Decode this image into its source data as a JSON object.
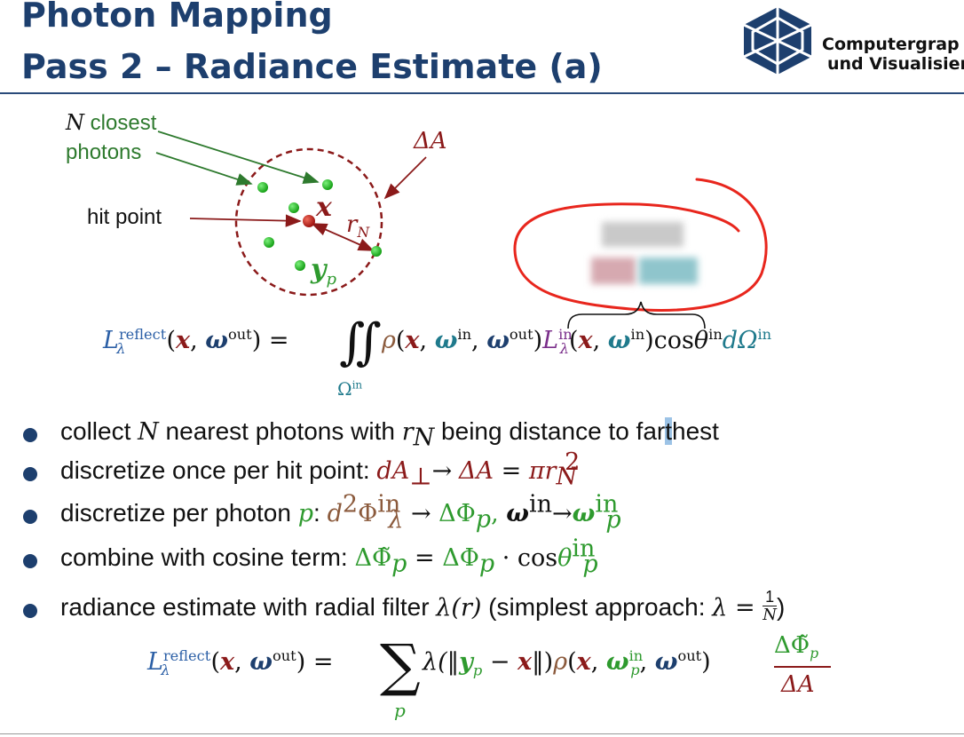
{
  "slide": {
    "title_line1": "Photon Mapping",
    "title_line2": "Pass 2 – Radiance Estimate (a)",
    "logo_text_line1": "Computergrap",
    "logo_text_line2": "und Visualisier"
  },
  "diagram": {
    "label_N": "N",
    "label_closest": "closest",
    "label_photons": "photons",
    "label_deltaA": "ΔA",
    "label_hit_point": "hit point",
    "label_x": "x",
    "label_r": "r",
    "label_r_sub": "N",
    "label_y": "y",
    "label_y_sub": "p"
  },
  "equation1": {
    "lhs_L": "L",
    "lhs_sup": "reflect",
    "lhs_sub": "λ",
    "lhs_args_open": "(",
    "lhs_x": "x",
    "lhs_comma": ", ",
    "lhs_omega": "ω",
    "lhs_omega_sup": "out",
    "lhs_args_close": ") =",
    "integral": "∬",
    "integral_sub": "Ω",
    "integral_sub_sup": "in",
    "rho": "ρ",
    "rho_args_open": "(",
    "rho_x": "x",
    "rho_comma1": ", ",
    "rho_omega_in": "ω",
    "rho_omega_in_sup": "in",
    "rho_comma2": ", ",
    "rho_omega_out": "ω",
    "rho_omega_out_sup": "out",
    "rho_args_close": ")",
    "Lin": "L",
    "Lin_sup": "in",
    "Lin_sub": "λ",
    "Lin_args_open": "(",
    "Lin_x": "x",
    "Lin_comma": ", ",
    "Lin_omega": "ω",
    "Lin_omega_sup": "in",
    "Lin_args_close": ")",
    "cos": "cos",
    "theta": "θ",
    "theta_sup": "in",
    "dOmega": "dΩ",
    "dOmega_sup": "in"
  },
  "bullets": [
    {
      "t1": "collect ",
      "N": "N",
      "t2": " nearest photons with ",
      "r": "r",
      "r_sub": "N",
      "t3": " being distance to far",
      "t_highlight": "t",
      "t4": "hest"
    },
    {
      "t1": "discretize once per hit point: ",
      "dA": "dA",
      "dA_sub": "⊥",
      "arrow": "→",
      "dA2": "ΔA",
      "eq": " = ",
      "pi": "πr",
      "pi_sub": "N",
      "pi_sup": "2"
    },
    {
      "t1": "discretize per photon ",
      "p": "p",
      "colon": ": ",
      "d2phi": "d",
      "d2phi_sup": "2",
      "Phi": "Φ",
      "Phi_sup": "in",
      "Phi_sub": "λ",
      "arrow1": " → ",
      "dPhi": "ΔΦ",
      "dPhi_sub": "p",
      "comma": ", ",
      "omega": "ω",
      "omega_sup": "in",
      "arrow2": "→",
      "omega_p": "ω",
      "omega_p_sup": "in",
      "omega_p_sub": "p"
    },
    {
      "t1": "combine with cosine term: ",
      "dPhiT": "ΔΦ̃",
      "dPhiT_sub": "p",
      "eq": " = ",
      "dPhi": "ΔΦ",
      "dPhi_sub": "p",
      "dot": " · cos",
      "theta": "θ",
      "theta_sup": "in",
      "theta_sub": "p"
    },
    {
      "t1": "radiance estimate with radial filter ",
      "lambda": "λ(r)",
      "t2": " (simplest approach: ",
      "lambda2": "λ",
      "eq": " = ",
      "frac_num": "1",
      "frac_den": "N",
      "t3": ")"
    }
  ],
  "equation2": {
    "lhs_L": "L",
    "lhs_sup": "reflect",
    "lhs_sub": "λ",
    "lhs_open": "(",
    "lhs_x": "x",
    "lhs_comma": ", ",
    "lhs_omega": "ω",
    "lhs_omega_sup": "out",
    "lhs_close": ") =",
    "sum": "∑",
    "sum_sub": "p",
    "lambda": "λ(‖",
    "y": "y",
    "y_sub": "p",
    "minus": " − ",
    "x": "x",
    "norm_close": "‖)",
    "rho": "ρ",
    "rho_open": "(",
    "rho_x": "x",
    "rho_comma1": ", ",
    "rho_omega_p": "ω",
    "rho_omega_p_sup": "in",
    "rho_omega_p_sub": "p",
    "rho_comma2": ", ",
    "rho_omega_out": "ω",
    "rho_omega_out_sup": "out",
    "rho_close": ")",
    "frac_num": "ΔΦ̃",
    "frac_num_sub": "p",
    "frac_den": "ΔA"
  },
  "colors": {
    "title": "#1d3f6e",
    "divider": "#2a4a7a",
    "photon_green": "#27b327",
    "hit_point_red": "#b3201c",
    "circle_dash": "#8b1a1a",
    "annotation_red": "#e8261d"
  }
}
